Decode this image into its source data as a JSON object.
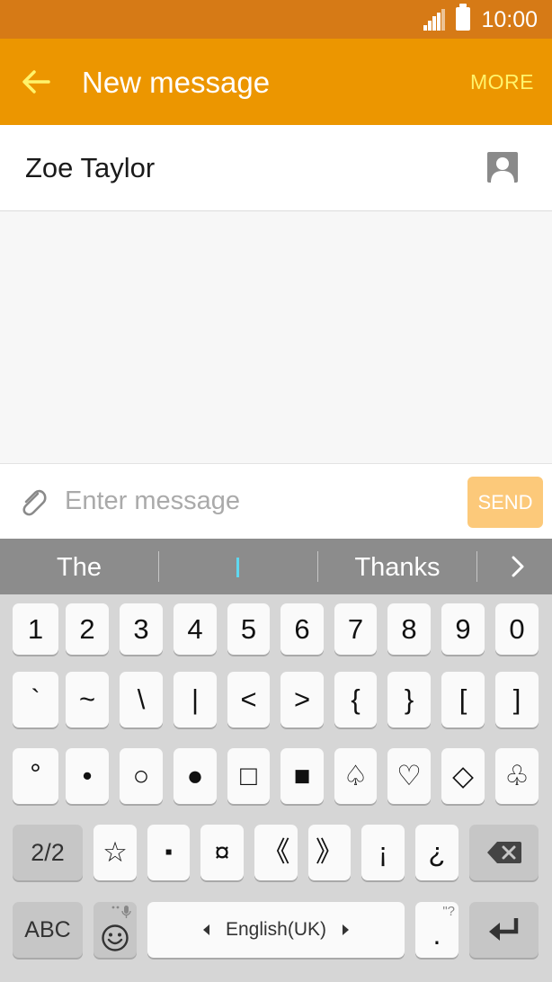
{
  "status_bar": {
    "time": "10:00",
    "icons": [
      "signal-icon",
      "battery-icon"
    ]
  },
  "app_bar": {
    "back_icon": "arrow-left-icon",
    "title": "New message",
    "more_label": "MORE"
  },
  "recipient": {
    "name": "Zoe Taylor",
    "icon": "contact-icon"
  },
  "composer": {
    "attach_icon": "paperclip-icon",
    "placeholder": "Enter message",
    "send_label": "SEND"
  },
  "suggestions": {
    "items": [
      "The",
      "",
      "Thanks"
    ],
    "next_icon": "chevron-right-icon"
  },
  "keyboard": {
    "row1": [
      "1",
      "2",
      "3",
      "4",
      "5",
      "6",
      "7",
      "8",
      "9",
      "0"
    ],
    "row2": [
      "`",
      "~",
      "\\",
      "|",
      "<",
      ">",
      "{",
      "}",
      "[",
      "]"
    ],
    "row3": [
      "°",
      "•",
      "○",
      "●",
      "□",
      "■",
      "♤",
      "♡",
      "◇",
      "♧"
    ],
    "row4": {
      "page": "2/2",
      "keys": [
        "☆",
        "▪",
        "¤",
        "《",
        "》",
        "¡",
        "¿"
      ],
      "backspace_icon": "backspace-icon"
    },
    "row5": {
      "abc": "ABC",
      "emoji_icon": "emoji-icon",
      "mic_icon": "mic-icon",
      "language": "English(UK)",
      "period": ".",
      "period_hint": "\"?",
      "enter_icon": "enter-icon"
    }
  },
  "colors": {
    "status_bar": "#d67a16",
    "app_bar": "#ec9600",
    "more": "#fff36b",
    "send_disabled": "#fcc97a",
    "suggestion_bar": "#8c8c8c",
    "keyboard_bg": "#d6d6d6"
  }
}
